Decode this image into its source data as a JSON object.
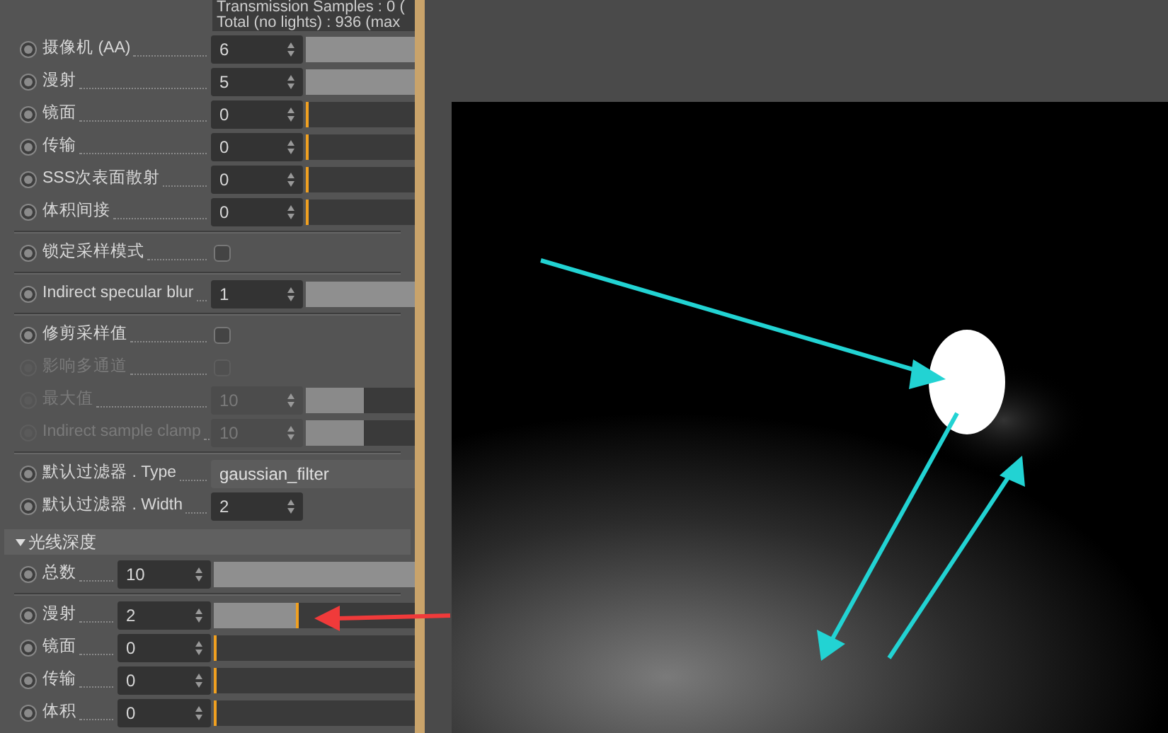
{
  "info_lines": [
    "Transmission Samples : 0 (",
    "Total (no lights) : 936 (max"
  ],
  "groups": [
    {
      "rows": [
        {
          "kind": "number",
          "label": "摄像机 (AA)",
          "value": "6",
          "level": 1,
          "disabled": false
        },
        {
          "kind": "number",
          "label": "漫射",
          "value": "5",
          "level": 1,
          "disabled": false
        },
        {
          "kind": "number",
          "label": "镜面",
          "value": "0",
          "level": 0,
          "disabled": false
        },
        {
          "kind": "number",
          "label": "传输",
          "value": "0",
          "level": 0,
          "disabled": false
        },
        {
          "kind": "number",
          "label": "SSS次表面散射",
          "value": "0",
          "level": 0,
          "disabled": false
        },
        {
          "kind": "number",
          "label": "体积间接",
          "value": "0",
          "level": 0,
          "disabled": false
        }
      ]
    },
    {
      "rows": [
        {
          "kind": "checkbox",
          "label": "锁定采样模式",
          "checked": false,
          "disabled": false
        }
      ]
    },
    {
      "rows": [
        {
          "kind": "number",
          "label": "Indirect specular blur",
          "value": "1",
          "level": 1,
          "disabled": false
        }
      ]
    },
    {
      "rows": [
        {
          "kind": "checkbox",
          "label": "修剪采样值",
          "checked": false,
          "disabled": false
        },
        {
          "kind": "checkbox",
          "label": "影响多通道",
          "checked": false,
          "disabled": true
        },
        {
          "kind": "number",
          "label": "最大值",
          "value": "10",
          "level": 0.53,
          "disabled": true
        },
        {
          "kind": "number",
          "label": "Indirect sample clamp",
          "value": "10",
          "level": 0.53,
          "disabled": true
        }
      ]
    },
    {
      "rows": [
        {
          "kind": "dropdown",
          "label": "默认过滤器 . Type",
          "value": "gaussian_filter",
          "disabled": false
        },
        {
          "kind": "field",
          "label": "默认过滤器 . Width",
          "value": "2",
          "disabled": false
        }
      ]
    }
  ],
  "section": {
    "title": "光线深度",
    "expanded": true,
    "groups": [
      {
        "rows": [
          {
            "kind": "number",
            "label": "总数",
            "value": "10",
            "level": 1,
            "disabled": false
          }
        ]
      },
      {
        "rows": [
          {
            "kind": "number",
            "label": "漫射",
            "value": "2",
            "level": 0.41,
            "disabled": false
          },
          {
            "kind": "number",
            "label": "镜面",
            "value": "0",
            "level": 0,
            "disabled": false
          },
          {
            "kind": "number",
            "label": "传输",
            "value": "0",
            "level": 0,
            "disabled": false
          },
          {
            "kind": "number",
            "label": "体积",
            "value": "0",
            "level": 0,
            "disabled": false
          }
        ]
      }
    ]
  }
}
